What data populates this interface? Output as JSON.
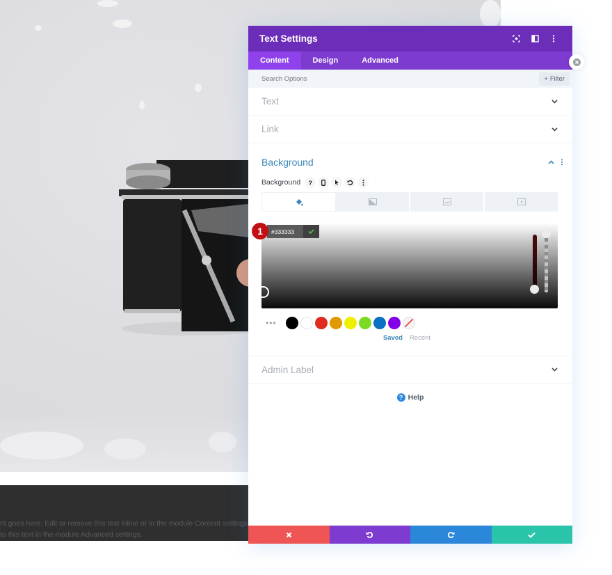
{
  "background_page": {
    "body_text_lines": [
      "nt goes here. Edit or remove this text inline or in the module Content settings. You",
      " to this text in the module Advanced settings."
    ]
  },
  "panel": {
    "title": "Text Settings",
    "header_icons": [
      "fullscreen-icon",
      "split-view-icon",
      "more-vertical-icon"
    ],
    "tabs": [
      {
        "label": "Content",
        "active": true
      },
      {
        "label": "Design",
        "active": false
      },
      {
        "label": "Advanced",
        "active": false
      }
    ],
    "search": {
      "placeholder": "Search Options",
      "value": ""
    },
    "filter_label": "Filter",
    "sections": {
      "text": {
        "title": "Text",
        "expanded": false
      },
      "link": {
        "title": "Link",
        "expanded": false
      },
      "background": {
        "title": "Background",
        "expanded": true
      },
      "admin_label": {
        "title": "Admin Label",
        "expanded": false
      }
    },
    "background_field": {
      "label": "Background",
      "option_icons": [
        "help-icon",
        "mobile-icon",
        "cursor-icon",
        "reset-icon",
        "more-icon"
      ],
      "type_tabs": [
        {
          "name": "color",
          "active": true
        },
        {
          "name": "gradient",
          "active": false
        },
        {
          "name": "image",
          "active": false
        },
        {
          "name": "video",
          "active": false
        }
      ],
      "color_picker": {
        "hex_value": "#333333",
        "step_badge": "1",
        "swatches": [
          "#000000",
          "#ffffff",
          "#e02b20",
          "#e09900",
          "#edf000",
          "#7cda24",
          "#0c71c3",
          "#8300e9"
        ],
        "swatch_tabs": {
          "saved": "Saved",
          "recent": "Recent",
          "active": "saved"
        }
      }
    },
    "help_label": "Help",
    "footer": {
      "colors": {
        "cancel": "#ef5555",
        "undo": "#7e3bd0",
        "redo": "#2b87da",
        "save": "#29c4a9"
      }
    }
  },
  "colors": {
    "header": "#6c2eb9",
    "tabs_bar": "#7d3bd0",
    "active_tab": "#8f42ec",
    "accent_blue": "#3b86b8"
  }
}
